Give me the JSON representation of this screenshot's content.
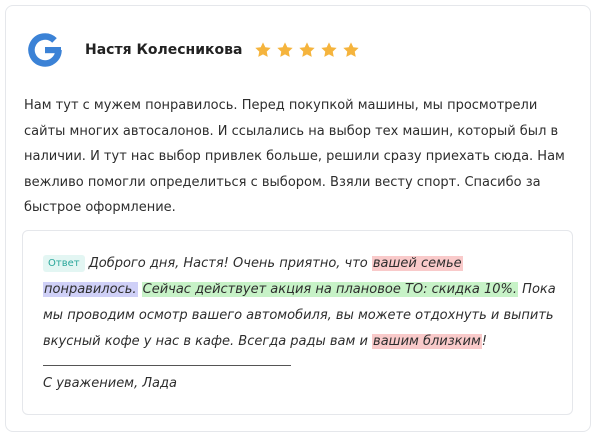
{
  "review": {
    "author": "Настя Колесникова",
    "rating": 5,
    "text": "Нам тут с мужем понравилось. Перед покупкой машины, мы просмотрели сайты многих автосалонов. И ссылались на выбор тех машин, который был в наличии. И тут нас выбор привлек больше, решили сразу приехать сюда. Нам вежливо помогли определиться с выбором. Взяли весту спорт. Спасибо за быстрое оформление."
  },
  "icons": {
    "source": "google-g-icon",
    "star": "star-icon"
  },
  "colors": {
    "star": "#f5b43d",
    "badge_text": "#2aa79b",
    "badge_bg": "#e3f6f3",
    "highlight_red": "#f9caca",
    "highlight_blue": "#cfd0f7",
    "highlight_green": "#c7f2c7"
  },
  "reply": {
    "badge": "Ответ",
    "seg1": "Доброго дня, Настя! Очень приятно, что ",
    "hl1": "вашей семье",
    "seg2": " ",
    "hl2": "понравилось.",
    "seg3": " ",
    "hl3": "Сейчас действует акция на плановое ТО: скидка 10%.",
    "seg4": " Пока мы проводим осмотр вашего автомобиля, вы можете отдохнуть и выпить вкусный кофе у нас в кафе. Всегда рады вам и ",
    "hl4": "вашим близким",
    "seg5": "!",
    "signature": "С уважением, Лада"
  }
}
